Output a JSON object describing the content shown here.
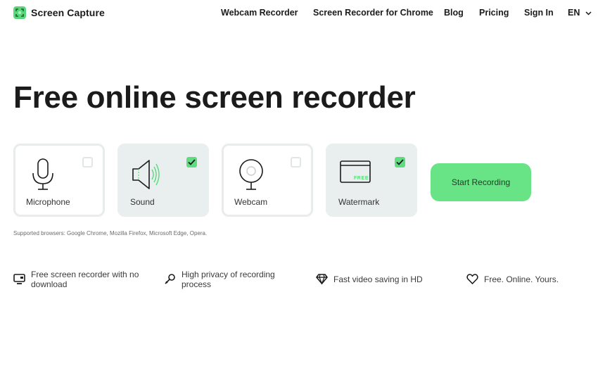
{
  "header": {
    "brand": "Screen Capture",
    "nav": [
      {
        "label": "Webcam Recorder"
      },
      {
        "label": "Screen Recorder for Chrome"
      },
      {
        "label": "Blog"
      },
      {
        "label": "Pricing"
      },
      {
        "label": "Sign In"
      }
    ],
    "language": "EN"
  },
  "hero": {
    "title": "Free online screen recorder"
  },
  "options": [
    {
      "label": "Microphone",
      "icon": "microphone-icon",
      "checked": false
    },
    {
      "label": "Sound",
      "icon": "speaker-icon",
      "checked": true
    },
    {
      "label": "Webcam",
      "icon": "webcam-icon",
      "checked": false
    },
    {
      "label": "Watermark",
      "icon": "watermark-icon",
      "checked": true,
      "badge": "FREE"
    }
  ],
  "start_button": "Start Recording",
  "supported_browsers": "Supported browsers: Google Chrome, Mozilla Firefox, Microsoft Edge, Opera.",
  "features": [
    {
      "icon": "monitor-icon",
      "line1": "Free screen recorder with no",
      "line2": "download"
    },
    {
      "icon": "key-icon",
      "line1": "High privacy of recording",
      "line2": "process"
    },
    {
      "icon": "diamond-icon",
      "text": "Fast video saving in HD"
    },
    {
      "icon": "heart-icon",
      "text": "Free. Online. Yours."
    }
  ],
  "colors": {
    "accent": "#68e486",
    "checkbox_checked": "#5fdc7f",
    "card_selected_bg": "#e9eeef",
    "text": "#1b1b1b"
  }
}
